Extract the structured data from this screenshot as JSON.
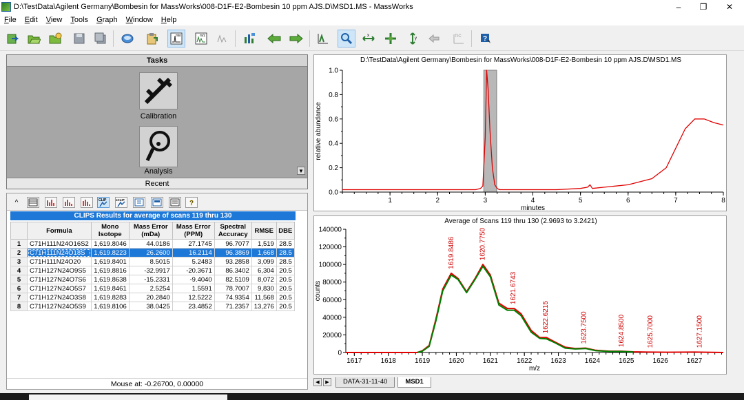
{
  "window": {
    "title": "D:\\TestData\\Agilent Germany\\Bombesin for MassWorks\\008-D1F-E2-Bombesin 10 ppm AJS.D\\MSD1.MS - MassWorks",
    "controls": {
      "minimize": "–",
      "maximize": "❐",
      "close": "✕"
    }
  },
  "menu": [
    "File",
    "Edit",
    "View",
    "Tools",
    "Graph",
    "Window",
    "Help"
  ],
  "tasks": {
    "header": "Tasks",
    "calibration_label": "Calibration",
    "analysis_label": "Analysis",
    "recent_label": "Recent"
  },
  "clips": {
    "title": "CLIPS Results for average of scans 119 thru 130",
    "toolbar_label": "CLIP",
    "columns": [
      "Formula",
      "Mono Isotope",
      "Mass Error (mDa)",
      "Mass Error (PPM)",
      "Spectral Accuracy",
      "RMSE",
      "DBE"
    ],
    "selected_row": 2,
    "rows": [
      {
        "n": "1",
        "formula": "C71H111N24O16S2",
        "mono": "1,619.8046",
        "mda": "44.0186",
        "ppm": "27.1745",
        "acc": "96.7077",
        "rmse": "1,519",
        "dbe": "28.5"
      },
      {
        "n": "2",
        "formula": "C71H111N24O18S",
        "mono": "1,619.8223",
        "mda": "26.2600",
        "ppm": "16.2114",
        "acc": "96.3869",
        "rmse": "1,668",
        "dbe": "28.5"
      },
      {
        "n": "3",
        "formula": "C71H111N24O20",
        "mono": "1,619.8401",
        "mda": "8.5015",
        "ppm": "5.2483",
        "acc": "93.2858",
        "rmse": "3,099",
        "dbe": "28.5"
      },
      {
        "n": "4",
        "formula": "C71H127N24O9S5",
        "mono": "1,619.8816",
        "mda": "-32.9917",
        "ppm": "-20.3671",
        "acc": "86.3402",
        "rmse": "6,304",
        "dbe": "20.5"
      },
      {
        "n": "5",
        "formula": "C71H127N24O7S6",
        "mono": "1,619.8638",
        "mda": "-15.2331",
        "ppm": "-9.4040",
        "acc": "82.5109",
        "rmse": "8,072",
        "dbe": "20.5"
      },
      {
        "n": "6",
        "formula": "C71H127N24O5S7",
        "mono": "1,619.8461",
        "mda": "2.5254",
        "ppm": "1.5591",
        "acc": "78.7007",
        "rmse": "9,830",
        "dbe": "20.5"
      },
      {
        "n": "7",
        "formula": "C71H127N24O3S8",
        "mono": "1,619.8283",
        "mda": "20.2840",
        "ppm": "12.5222",
        "acc": "74.9354",
        "rmse": "11,568",
        "dbe": "20.5"
      },
      {
        "n": "8",
        "formula": "C71H127N24O5S9",
        "mono": "1,619.8106",
        "mda": "38.0425",
        "ppm": "23.4852",
        "acc": "71.2357",
        "rmse": "13,276",
        "dbe": "20.5"
      }
    ]
  },
  "status": "Mouse at: -0.26700, 0.00000",
  "sheets": {
    "tabs": [
      "DATA-31-11-40",
      "MSD1"
    ],
    "active": "MSD1"
  },
  "colors": {
    "selection": "#1e78d7",
    "trace_red": "#e00000",
    "trace_green": "#008000",
    "band": "#b8b8b8"
  },
  "chart_data": [
    {
      "type": "line",
      "title": "D:\\TestData\\Agilent Germany\\Bombesin for MassWorks\\008-D1F-E2-Bombesin 10 ppm AJS.D\\MSD1.MS",
      "xlabel": "minutes",
      "ylabel": "relative abundance",
      "xlim": [
        0,
        8
      ],
      "ylim": [
        0,
        1
      ],
      "xticks": [
        "1",
        "2",
        "3",
        "4",
        "5",
        "6",
        "7",
        "8"
      ],
      "yticks": [
        "0.0",
        "0.2",
        "0.4",
        "0.6",
        "0.8",
        "1.0"
      ],
      "highlight_range": [
        2.97,
        3.24
      ],
      "series": [
        {
          "color": "#e00000",
          "x": [
            0,
            0.5,
            1,
            1.5,
            2,
            2.5,
            2.8,
            2.9,
            2.95,
            3.0,
            3.03,
            3.06,
            3.1,
            3.15,
            3.2,
            3.25,
            3.3,
            3.5,
            4,
            4.5,
            5,
            5.15,
            5.2,
            5.25,
            5.5,
            6,
            6.5,
            6.8,
            7.0,
            7.2,
            7.4,
            7.6,
            7.8,
            8.0
          ],
          "y": [
            0.02,
            0.02,
            0.02,
            0.02,
            0.02,
            0.02,
            0.02,
            0.03,
            0.05,
            0.45,
            1.0,
            0.85,
            0.5,
            0.2,
            0.06,
            0.03,
            0.02,
            0.02,
            0.02,
            0.02,
            0.03,
            0.04,
            0.06,
            0.03,
            0.04,
            0.06,
            0.11,
            0.2,
            0.36,
            0.52,
            0.6,
            0.6,
            0.57,
            0.55
          ]
        }
      ]
    },
    {
      "type": "line",
      "title": "Average of Scans 119 thru 130 (2.9693 to 3.2421)",
      "xlabel": "m/z",
      "ylabel": "counts",
      "xlim": [
        1616.75,
        1627.85
      ],
      "ylim": [
        0,
        140000
      ],
      "xticks": [
        "1617",
        "1618",
        "1619",
        "1620",
        "1621",
        "1622",
        "1623",
        "1624",
        "1625",
        "1626",
        "1627"
      ],
      "yticks": [
        "0",
        "20000",
        "40000",
        "60000",
        "80000",
        "100000",
        "120000",
        "140000"
      ],
      "peak_labels": [
        {
          "x": 1619.8486,
          "label": "1619.8486",
          "y": 90000
        },
        {
          "x": 1620.775,
          "label": "1620.7750",
          "y": 100000
        },
        {
          "x": 1621.6743,
          "label": "1621.6743",
          "y": 50000
        },
        {
          "x": 1622.6215,
          "label": "1622.6215",
          "y": 17000
        },
        {
          "x": 1623.75,
          "label": "1623.7500",
          "y": 5000
        },
        {
          "x": 1624.85,
          "label": "1624.8500",
          "y": 1500
        },
        {
          "x": 1625.7,
          "label": "1625.7000",
          "y": 500
        },
        {
          "x": 1627.15,
          "label": "1627.1500",
          "y": 500
        }
      ],
      "series": [
        {
          "color": "#e00000",
          "x": [
            1616.75,
            1618.85,
            1619.0,
            1619.2,
            1619.4,
            1619.6,
            1619.85,
            1620.05,
            1620.3,
            1620.55,
            1620.78,
            1621.0,
            1621.25,
            1621.5,
            1621.7,
            1621.9,
            1622.2,
            1622.45,
            1622.65,
            1622.9,
            1623.2,
            1623.5,
            1623.8,
            1624.1,
            1624.5,
            1624.85,
            1625.2,
            1625.6,
            1626.2,
            1627.0,
            1627.85
          ],
          "y": [
            0,
            0,
            2000,
            8000,
            38000,
            72000,
            90000,
            84000,
            69000,
            84000,
            100000,
            88000,
            56000,
            50000,
            50000,
            44000,
            25000,
            17000,
            17000,
            12000,
            6000,
            4500,
            5000,
            2500,
            1500,
            1500,
            800,
            500,
            300,
            500,
            0
          ]
        },
        {
          "color": "#008000",
          "x": [
            1618.85,
            1619.0,
            1619.2,
            1619.4,
            1619.6,
            1619.85,
            1620.05,
            1620.3,
            1620.55,
            1620.78,
            1621.0,
            1621.25,
            1621.5,
            1621.7,
            1621.9,
            1622.2,
            1622.45,
            1622.65,
            1622.9,
            1623.2,
            1623.5,
            1623.8,
            1624.1,
            1624.5,
            1624.85,
            1625.2
          ],
          "y": [
            0,
            1500,
            7000,
            36000,
            70000,
            88000,
            83000,
            68000,
            83000,
            98000,
            86000,
            54000,
            48000,
            48000,
            42000,
            23000,
            16000,
            15500,
            11000,
            5000,
            4000,
            4500,
            2000,
            1200,
            1200,
            600
          ]
        }
      ]
    }
  ]
}
